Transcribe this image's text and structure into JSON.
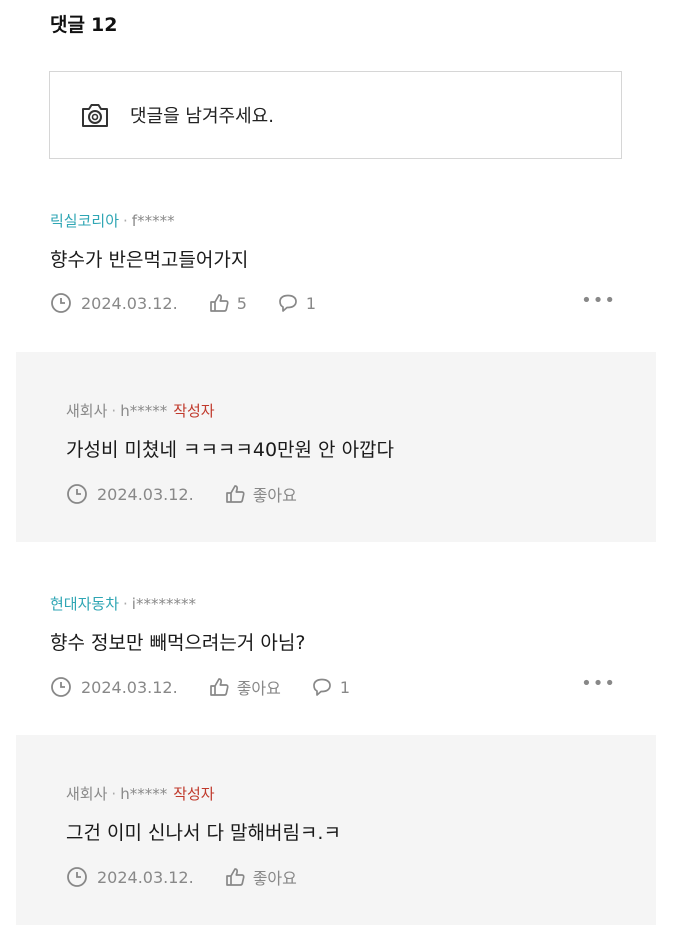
{
  "header": {
    "title": "댓글",
    "count": "12"
  },
  "input": {
    "placeholder": "댓글을 남겨주세요.",
    "icon": "camera-icon"
  },
  "comments": [
    {
      "author": "릭실코리아",
      "user_id": "f*****",
      "text": "향수가 반은먹고들어가지",
      "date": "2024.03.12.",
      "likes": "5",
      "replies": "1"
    },
    {
      "author": "새회사",
      "user_id": "h*****",
      "badge": "작성자",
      "text": "가성비 미쳤네 ㅋㅋㅋㅋ40만원 안 아깝다",
      "date": "2024.03.12.",
      "like_label": "좋아요"
    },
    {
      "author": "현대자동차",
      "user_id": "i********",
      "text": "향수 정보만 빼먹으려는거 아님?",
      "date": "2024.03.12.",
      "like_label": "좋아요",
      "replies": "1"
    },
    {
      "author": "새회사",
      "user_id": "h*****",
      "badge": "작성자",
      "text": "그건 이미 신나서 다 말해버림ㅋ.ㅋ",
      "date": "2024.03.12.",
      "like_label": "좋아요"
    }
  ],
  "colors": {
    "author": "#2fa6b4",
    "badge": "#c0392b",
    "reply_bg": "#f5f5f5"
  }
}
